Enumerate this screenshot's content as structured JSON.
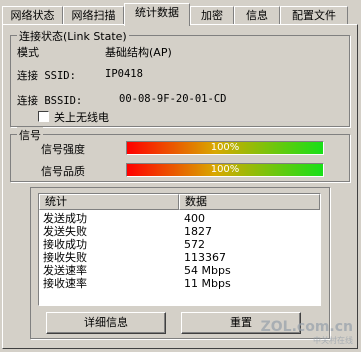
{
  "tabs": [
    "网络状态",
    "网络扫描",
    "统计数据",
    "加密",
    "信息",
    "配置文件"
  ],
  "link_state": {
    "title": "连接状态(Link State)",
    "rows": [
      {
        "label": "模式",
        "value": "基础结构(AP)"
      },
      {
        "label": "连接 SSID:",
        "value": "IP0418"
      },
      {
        "label": "连接 BSSID:",
        "value": "00-08-9F-20-01-CD"
      }
    ]
  },
  "radio_off": {
    "label": "关上无线电",
    "checked": false
  },
  "signal": {
    "title": "信号",
    "strength_label": "信号强度",
    "strength_value": "100%",
    "strength_level": 1.0,
    "quality_label": "信号品质",
    "quality_value": "100%",
    "quality_level": 1.0,
    "colors": {
      "low": "#ff0000",
      "mid": "#d8a800",
      "high": "#18e018"
    }
  },
  "stats": {
    "headers": [
      "统计",
      "数据"
    ],
    "rows": [
      {
        "name": "发送成功",
        "value": "400"
      },
      {
        "name": "发送失败",
        "value": "1827"
      },
      {
        "name": "接收成功",
        "value": "572"
      },
      {
        "name": "接收失败",
        "value": "113367"
      },
      {
        "name": "发送速率",
        "value": "54 Mbps"
      },
      {
        "name": "接收速率",
        "value": "11 Mbps"
      }
    ]
  },
  "buttons": {
    "details": "详细信息",
    "reset": "重置"
  },
  "watermark": {
    "site": "ZOL.com.cn",
    "sub": "中关村在线"
  }
}
